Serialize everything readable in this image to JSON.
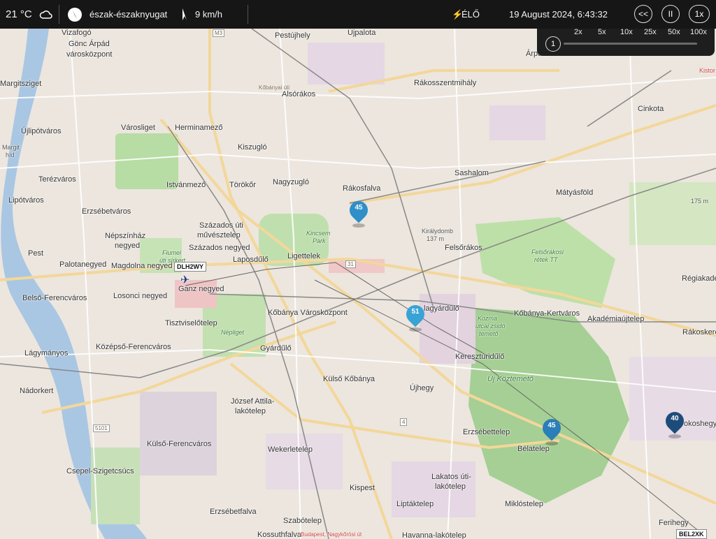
{
  "weather": {
    "temperature": "21 °C",
    "wind_direction": "észak-északnyugat",
    "wind_speed": "9 km/h"
  },
  "status": {
    "live_label": "ÉLŐ",
    "datetime": "19 August 2024, 6:43:32"
  },
  "playback": {
    "rewind_label": "<<",
    "pause_label": "II",
    "rate_label": "1x",
    "speeds": [
      "2x",
      "5x",
      "10x",
      "25x",
      "50x",
      "100x"
    ],
    "slider_value": "1"
  },
  "colors": {
    "topbar_bg": "#161616",
    "marker_light": "#2e8fc9",
    "marker_dark": "#1e4c7a",
    "accent_red": "#e07070"
  },
  "map": {
    "labels": [
      "Vizafogó",
      "Gönc Árpád",
      "városközpont",
      "Margitsziget",
      "Újlipótváros",
      "Margit",
      "híd",
      "Terézváros",
      "Lipótváros",
      "Pest",
      "Palotanegyed",
      "Belső-Ferencváros",
      "Lágymányos",
      "Nádorkert",
      "Csepel-Szigetcsúcs",
      "Középső-Ferencváros",
      "Losonci negyed",
      "Tisztviselőtelep",
      "Népszínház",
      "negyed",
      "Erzsébetváros",
      "Herminamező",
      "Városliget",
      "Istvánmező",
      "Százados úti",
      "művésztelep",
      "Százados negyed",
      "Magdolna negyed",
      "Ganz negyed",
      "Laposdűlő",
      "Ligettelek",
      "Kőbánya Városközpont",
      "Gyárdűlő",
      "József Attila-",
      "lakótelep",
      "Külső-Ferencváros",
      "Wekerletelep",
      "Erzsébetfalva",
      "Szabótelep",
      "Kossuthfalva",
      "Kispest",
      "Liptáktelep",
      "Havanna-lakótelep",
      "Lakatos úti-",
      "lakótelep",
      "Miklóstelep",
      "Bélatelep",
      "Erzsébettelep",
      "Újhegy",
      "Külső Kőbánya",
      "Keresztúridűlő",
      "Új Köztemető",
      "Kőbánya-Kertváros",
      "Akadémiaújtelep",
      "Felsőrákos",
      "Királydomb",
      "137 m",
      "Rákosfalva",
      "Sashalom",
      "Nagyzugló",
      "Törökőr",
      "Kiszugló",
      "Alsórákos",
      "Pestújhely",
      "Újpalota",
      "Rákosszentmihály",
      "Árpád",
      "Cinkota",
      "Mátyásföld",
      "175 m",
      "Régiakadé",
      "Rákoskere",
      "okoshegy",
      "Ferihegy",
      "Kistor",
      "Kincsem",
      "Park",
      "Felsőrákosi",
      "rétek TT",
      "Kozma",
      "utcai zsidó",
      "temető",
      "Népliget",
      "Fiumei",
      "úti sírkert",
      "Budapest, Nagykőrösi út",
      "Kőbányai úti",
      "lagyárdűlő"
    ],
    "road_numbers": [
      "M3",
      "31",
      "4",
      "5101"
    ],
    "markers": [
      {
        "label": "45",
        "style": "light"
      },
      {
        "label": "51",
        "style": "light"
      },
      {
        "label": "45",
        "style": "light"
      },
      {
        "label": "40",
        "style": "dark"
      }
    ],
    "flights": [
      "DLH2WY",
      "BEL2XK"
    ]
  }
}
